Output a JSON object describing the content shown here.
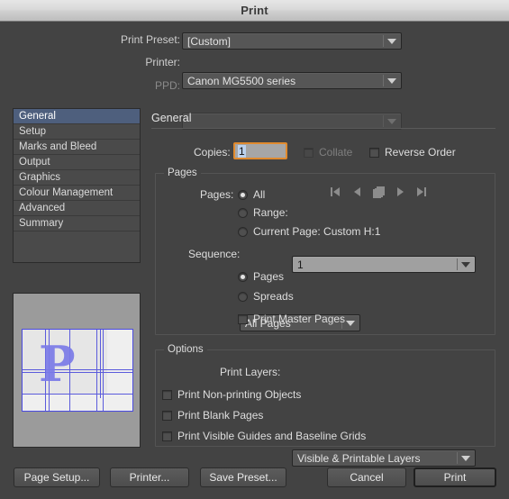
{
  "window": {
    "title": "Print"
  },
  "top": {
    "preset_label": "Print Preset:",
    "preset_value": "[Custom]",
    "printer_label": "Printer:",
    "printer_value": "Canon MG5500 series",
    "ppd_label": "PPD:",
    "ppd_value": ""
  },
  "sidebar": {
    "items": [
      {
        "label": "General",
        "selected": true
      },
      {
        "label": "Setup",
        "selected": false
      },
      {
        "label": "Marks and Bleed",
        "selected": false
      },
      {
        "label": "Output",
        "selected": false
      },
      {
        "label": "Graphics",
        "selected": false
      },
      {
        "label": "Colour Management",
        "selected": false
      },
      {
        "label": "Advanced",
        "selected": false
      },
      {
        "label": "Summary",
        "selected": false
      }
    ]
  },
  "preview": {
    "glyph": "P"
  },
  "main": {
    "section_title": "General",
    "copies_label": "Copies:",
    "copies_value": "1",
    "collate_label": "Collate",
    "reverse_order_label": "Reverse Order",
    "pages_group_label": "Pages",
    "pages_label": "Pages:",
    "all_label": "All",
    "range_label": "Range:",
    "range_value": "1",
    "current_page_label": "Current Page: Custom H:1",
    "sequence_label": "Sequence:",
    "sequence_value": "All Pages",
    "pages_radio_label": "Pages",
    "spreads_radio_label": "Spreads",
    "print_master_pages_label": "Print Master Pages",
    "options_group_label": "Options",
    "print_layers_label": "Print Layers:",
    "print_layers_value": "Visible & Printable Layers",
    "print_nonprinting_label": "Print Non-printing Objects",
    "print_blank_label": "Print Blank Pages",
    "print_guides_label": "Print Visible Guides and Baseline Grids"
  },
  "footer": {
    "page_setup": "Page Setup...",
    "printer": "Printer...",
    "save_preset": "Save Preset...",
    "cancel": "Cancel",
    "print": "Print"
  },
  "colors": {
    "window_bg": "#434343",
    "accent_focus": "#e08a2e",
    "selection_blue": "#4e5f7d",
    "guide_blue": "#5b5bdc"
  }
}
